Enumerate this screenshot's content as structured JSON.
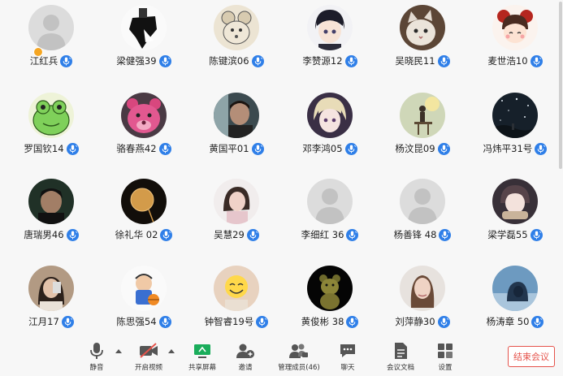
{
  "participants": [
    {
      "name": "江红兵",
      "host": true,
      "avatar": "default"
    },
    {
      "name": "梁健强39",
      "avatar": "dark-figure"
    },
    {
      "name": "陈键滨06",
      "avatar": "cartoon-mouse"
    },
    {
      "name": "李赞源12",
      "avatar": "anime-boy"
    },
    {
      "name": "吴晓民11",
      "avatar": "cat"
    },
    {
      "name": "麦世浩10",
      "avatar": "cartoon-girl"
    },
    {
      "name": "罗国钦14",
      "avatar": "green-frog"
    },
    {
      "name": "骆春燕42",
      "avatar": "pink-bear"
    },
    {
      "name": "黄国平01",
      "avatar": "man-portrait"
    },
    {
      "name": "邓李鸿05",
      "avatar": "anime-blond"
    },
    {
      "name": "杨汶昆09",
      "avatar": "sitting-figure"
    },
    {
      "name": "冯炜平31号",
      "avatar": "night-sky"
    },
    {
      "name": "唐瑞男46",
      "avatar": "dark-man"
    },
    {
      "name": "徐礼华 02",
      "avatar": "moon-lamp"
    },
    {
      "name": "吴慧29",
      "avatar": "girl-photo"
    },
    {
      "name": "李细红 36",
      "avatar": "default"
    },
    {
      "name": "杨善锋 48",
      "avatar": "default"
    },
    {
      "name": "梁学磊55",
      "avatar": "anime-scarf"
    },
    {
      "name": "江月17",
      "avatar": "selfie"
    },
    {
      "name": "陈思强54",
      "avatar": "basketball"
    },
    {
      "name": "钟智睿19号",
      "avatar": "smile-face"
    },
    {
      "name": "黄俊彬 38",
      "avatar": "teddy-dark"
    },
    {
      "name": "刘萍静30",
      "avatar": "woman-portrait"
    },
    {
      "name": "杨涛章 50",
      "avatar": "hood-person"
    }
  ],
  "toolbar": {
    "mute": "静音",
    "video": "开启视频",
    "share": "共享屏幕",
    "invite": "邀请",
    "members": "管理成员(46)",
    "chat": "聊天",
    "docs": "会议文档",
    "settings": "设置",
    "end": "结束会议"
  },
  "colors": {
    "mic_badge": "#2f7fe8",
    "end_button": "#e5534b",
    "host_badge": "#f5a623",
    "share_icon": "#1aad5b",
    "video_off": "#e5534b"
  }
}
